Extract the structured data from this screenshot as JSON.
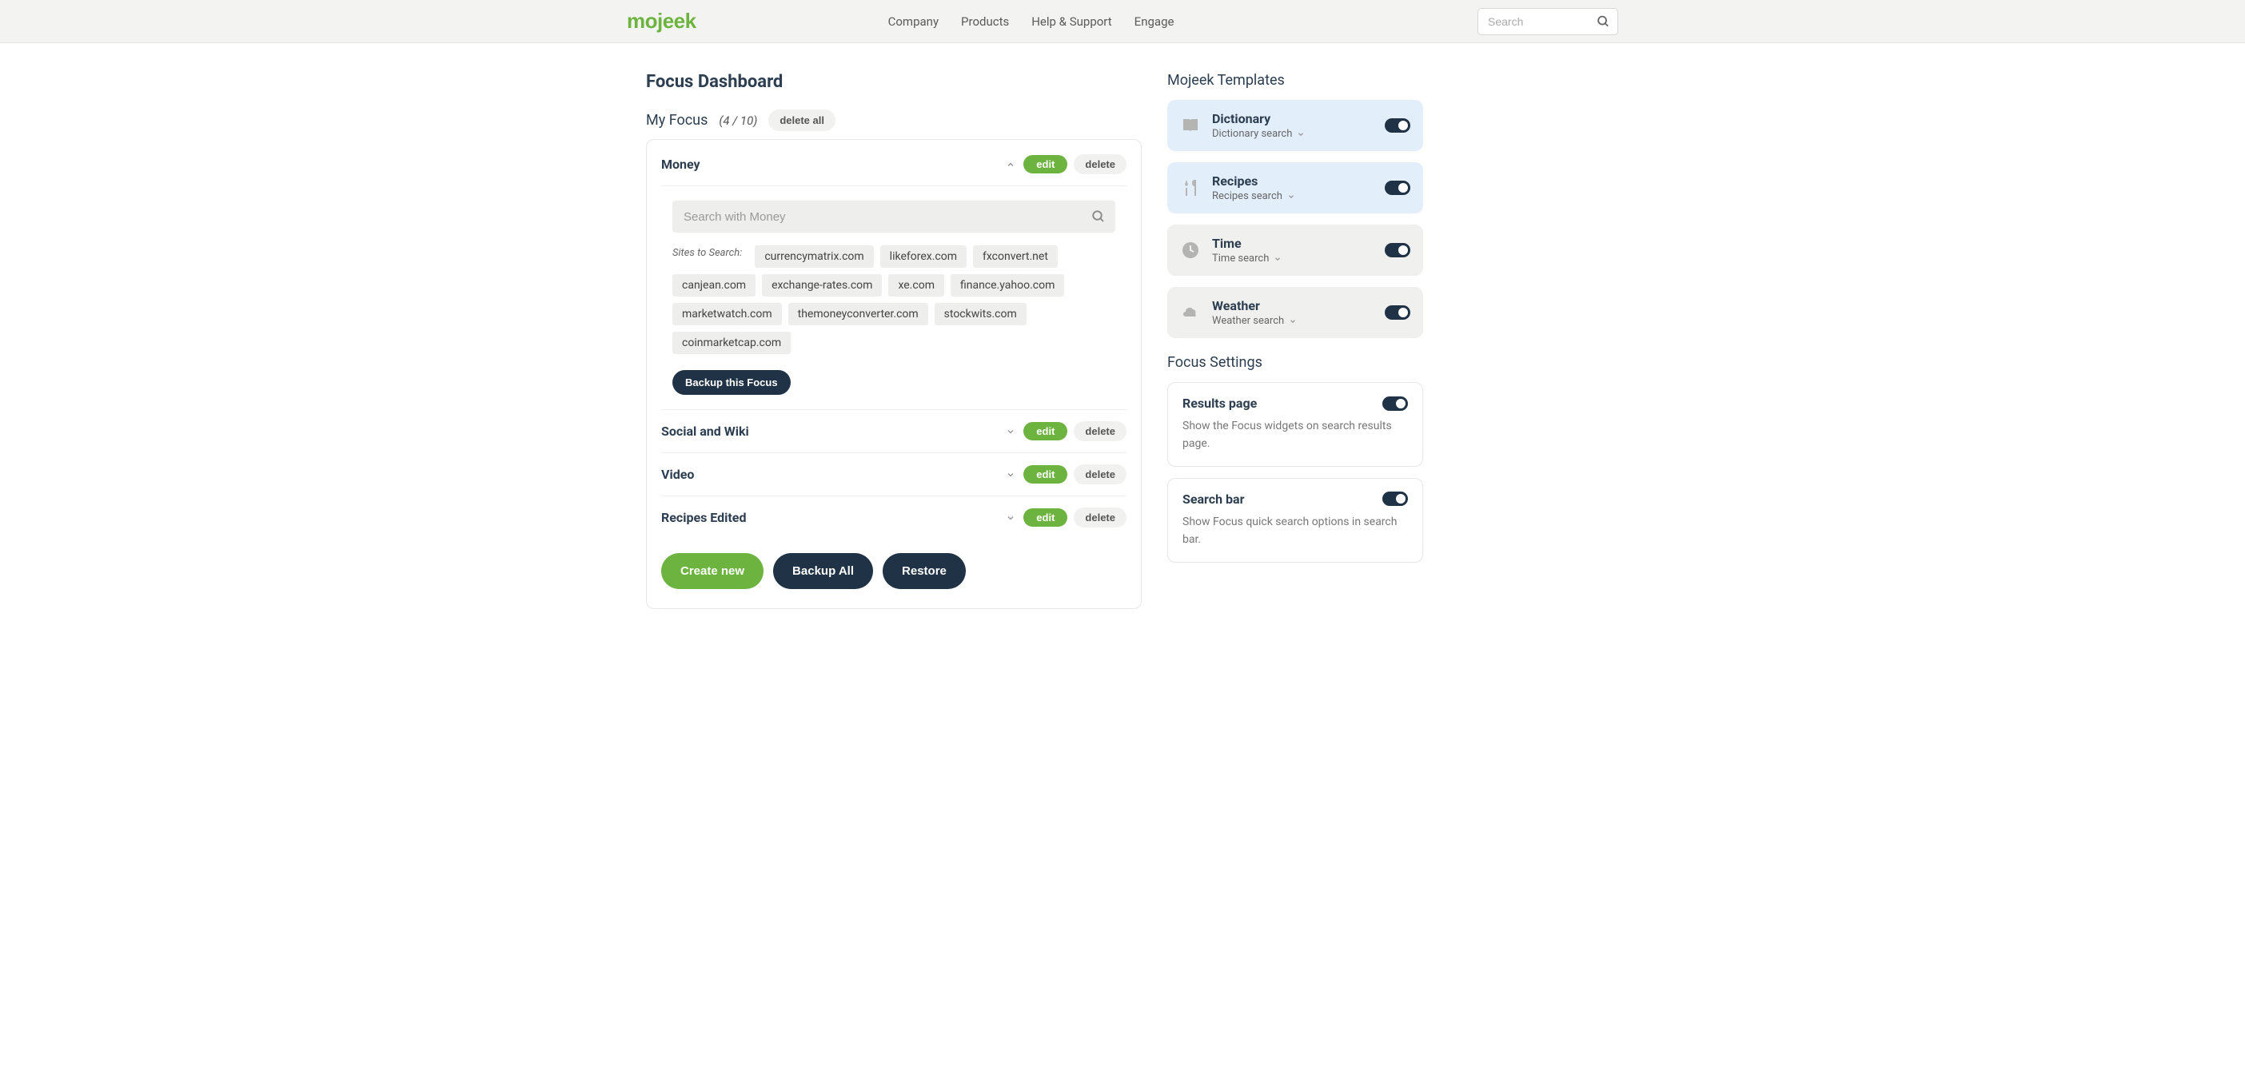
{
  "header": {
    "logo": "mojeek",
    "nav": [
      "Company",
      "Products",
      "Help & Support",
      "Engage"
    ],
    "search_placeholder": "Search"
  },
  "page_title": "Focus Dashboard",
  "myfocus": {
    "label": "My Focus",
    "count": "(4 / 10)",
    "delete_all": "delete all"
  },
  "focuses": [
    {
      "title": "Money",
      "expanded": true,
      "edit": "edit",
      "delete": "delete",
      "search_placeholder": "Search with Money",
      "sites_label": "Sites to Search:",
      "sites": [
        "currencymatrix.com",
        "likeforex.com",
        "fxconvert.net",
        "canjean.com",
        "exchange-rates.com",
        "xe.com",
        "finance.yahoo.com",
        "marketwatch.com",
        "themoneyconverter.com",
        "stockwits.com",
        "coinmarketcap.com"
      ],
      "backup": "Backup this Focus"
    },
    {
      "title": "Social and Wiki",
      "expanded": false,
      "edit": "edit",
      "delete": "delete"
    },
    {
      "title": "Video",
      "expanded": false,
      "edit": "edit",
      "delete": "delete"
    },
    {
      "title": "Recipes Edited",
      "expanded": false,
      "edit": "edit",
      "delete": "delete"
    }
  ],
  "actions": {
    "create": "Create new",
    "backup_all": "Backup All",
    "restore": "Restore"
  },
  "templates_heading": "Mojeek Templates",
  "templates": [
    {
      "title": "Dictionary",
      "sub": "Dictionary search",
      "icon": "book",
      "grey": false
    },
    {
      "title": "Recipes",
      "sub": "Recipes search",
      "icon": "utensils",
      "grey": false
    },
    {
      "title": "Time",
      "sub": "Time search",
      "icon": "clock",
      "grey": true
    },
    {
      "title": "Weather",
      "sub": "Weather search",
      "icon": "cloud",
      "grey": true
    }
  ],
  "settings_heading": "Focus Settings",
  "settings": [
    {
      "title": "Results page",
      "desc": "Show the Focus widgets on search results page."
    },
    {
      "title": "Search bar",
      "desc": "Show Focus quick search options in search bar."
    }
  ]
}
